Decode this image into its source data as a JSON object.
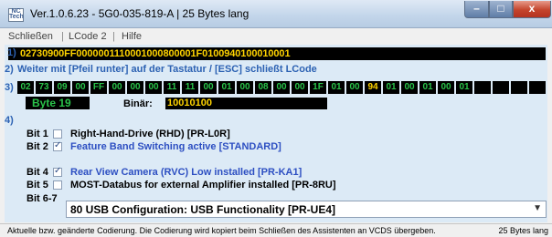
{
  "window": {
    "title": "Ver.1.0.6.23 -  5G0-035-819-A | 25 Bytes lang",
    "icon_label": "NC Tech",
    "buttons": {
      "minimize": "–",
      "maximize": "□",
      "close": "x"
    }
  },
  "menu": {
    "items": [
      "Schließen",
      "LCode 2",
      "Hilfe"
    ],
    "separator": "|"
  },
  "section1": {
    "number": "1)",
    "code": "02730900FF0000001110001000800001F0100940100010001"
  },
  "section2": {
    "number": "2)",
    "instruction": "Weiter mit [Pfeil runter] auf der Tastatur / [ESC] schließt LCode"
  },
  "section3": {
    "number": "3)",
    "bytes": [
      "02",
      "73",
      "09",
      "00",
      "FF",
      "00",
      "00",
      "00",
      "11",
      "11",
      "00",
      "01",
      "00",
      "08",
      "00",
      "00",
      "1F",
      "01",
      "00",
      "94",
      "01",
      "00",
      "01",
      "00",
      "01"
    ],
    "selected_index": 19,
    "byte_label": "Byte 19",
    "binar_label": "Binär:",
    "binar_value": "10010100"
  },
  "section4": {
    "number": "4)",
    "bits": [
      {
        "label": "Bit 1",
        "checked": false,
        "text": "Right-Hand-Drive (RHD) [PR-L0R]",
        "highlight": false
      },
      {
        "label": "Bit 2",
        "checked": true,
        "text": "Feature Band Switching active [STANDARD]",
        "highlight": true
      },
      {
        "label": "Bit 4",
        "checked": true,
        "text": "Rear View Camera (RVC) Low installed [PR-KA1]",
        "highlight": true
      },
      {
        "label": "Bit 5",
        "checked": false,
        "text": "MOST-Databus for external Amplifier installed [PR-8RU]",
        "highlight": false
      }
    ],
    "bit67_label": "Bit 6-7",
    "bit67_value": "80 USB Configuration: USB Functionality [PR-UE4]"
  },
  "status": {
    "left": "Aktuelle bzw. geänderte Codierung. Die Codierung wird kopiert beim Schließen des Assistenten an VCDS übergeben.",
    "right": "25 Bytes lang"
  },
  "colors": {
    "accent_blue": "#2d62b3",
    "yellow": "#ffd400",
    "green": "#2ac34a",
    "content_bg": "#dceaf6"
  }
}
